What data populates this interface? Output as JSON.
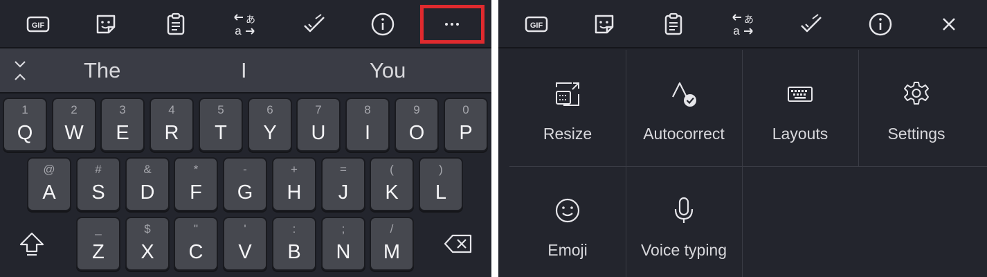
{
  "left_panel": {
    "toolbar": {
      "icons": [
        "gif-icon",
        "sticker-icon",
        "clipboard-icon",
        "translate-icon",
        "spellcheck-icon",
        "info-icon",
        "more-icon"
      ],
      "gif_text": "GIF",
      "translate_glyph": "あ",
      "translate_latin": "a",
      "highlight_color": "#e02a2e"
    },
    "suggestions": [
      "The",
      "I",
      "You"
    ],
    "keyboard": {
      "row1": [
        {
          "main": "Q",
          "sub": "1"
        },
        {
          "main": "W",
          "sub": "2"
        },
        {
          "main": "E",
          "sub": "3"
        },
        {
          "main": "R",
          "sub": "4"
        },
        {
          "main": "T",
          "sub": "5"
        },
        {
          "main": "Y",
          "sub": "6"
        },
        {
          "main": "U",
          "sub": "7"
        },
        {
          "main": "I",
          "sub": "8"
        },
        {
          "main": "O",
          "sub": "9"
        },
        {
          "main": "P",
          "sub": "0"
        }
      ],
      "row2": [
        {
          "main": "A",
          "sub": "@"
        },
        {
          "main": "S",
          "sub": "#"
        },
        {
          "main": "D",
          "sub": "&"
        },
        {
          "main": "F",
          "sub": "*"
        },
        {
          "main": "G",
          "sub": "-"
        },
        {
          "main": "H",
          "sub": "+"
        },
        {
          "main": "J",
          "sub": "="
        },
        {
          "main": "K",
          "sub": "("
        },
        {
          "main": "L",
          "sub": ")"
        }
      ],
      "row3": [
        {
          "main": "Z",
          "sub": "_"
        },
        {
          "main": "X",
          "sub": "$"
        },
        {
          "main": "C",
          "sub": "\""
        },
        {
          "main": "V",
          "sub": "'"
        },
        {
          "main": "B",
          "sub": ":"
        },
        {
          "main": "N",
          "sub": ";"
        },
        {
          "main": "M",
          "sub": "/"
        }
      ]
    }
  },
  "right_panel": {
    "toolbar": {
      "icons": [
        "gif-icon",
        "sticker-icon",
        "clipboard-icon",
        "translate-icon",
        "spellcheck-icon",
        "info-icon",
        "close-icon"
      ],
      "gif_text": "GIF",
      "translate_glyph": "あ",
      "translate_latin": "a"
    },
    "menu": {
      "resize": "Resize",
      "autocorrect": "Autocorrect",
      "layouts": "Layouts",
      "settings": "Settings",
      "emoji": "Emoji",
      "voice_typing": "Voice typing"
    }
  },
  "colors": {
    "background": "#23252d",
    "suggestion_bar": "#3a3c45",
    "key": "#46484f",
    "text": "#f5f5f7"
  }
}
